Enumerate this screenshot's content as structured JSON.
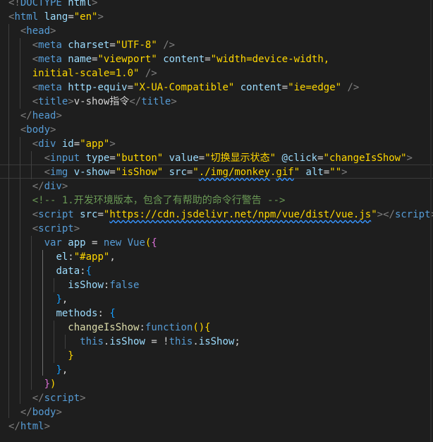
{
  "editor": {
    "lines": [
      [
        {
          "c": "t-punct",
          "t": "<!"
        },
        {
          "c": "t-tag",
          "t": "DOCTYPE"
        },
        {
          "c": "t-attr",
          "t": " html"
        },
        {
          "c": "t-punct",
          "t": ">"
        }
      ],
      [
        {
          "c": "t-punct",
          "t": "<"
        },
        {
          "c": "t-tag",
          "t": "html"
        },
        {
          "c": "t-attr",
          "t": " lang"
        },
        {
          "c": "t-text",
          "t": "="
        },
        {
          "c": "t-str",
          "t": "\"en\""
        },
        {
          "c": "t-punct",
          "t": ">"
        }
      ],
      [
        {
          "c": "t-text",
          "t": "  "
        },
        {
          "c": "t-punct",
          "t": "<"
        },
        {
          "c": "t-tag",
          "t": "head"
        },
        {
          "c": "t-punct",
          "t": ">"
        }
      ],
      [
        {
          "c": "t-text",
          "t": "    "
        },
        {
          "c": "t-punct",
          "t": "<"
        },
        {
          "c": "t-tag",
          "t": "meta"
        },
        {
          "c": "t-attr",
          "t": " charset"
        },
        {
          "c": "t-text",
          "t": "="
        },
        {
          "c": "t-str",
          "t": "\"UTF-8\""
        },
        {
          "c": "t-text",
          "t": " "
        },
        {
          "c": "t-punct",
          "t": "/>"
        }
      ],
      [
        {
          "c": "t-text",
          "t": "    "
        },
        {
          "c": "t-punct",
          "t": "<"
        },
        {
          "c": "t-tag",
          "t": "meta"
        },
        {
          "c": "t-attr",
          "t": " name"
        },
        {
          "c": "t-text",
          "t": "="
        },
        {
          "c": "t-str",
          "t": "\"viewport\""
        },
        {
          "c": "t-attr",
          "t": " content"
        },
        {
          "c": "t-text",
          "t": "="
        },
        {
          "c": "t-str",
          "t": "\"width=device-width,"
        }
      ],
      [
        {
          "c": "t-str",
          "t": "    initial-scale=1.0\""
        },
        {
          "c": "t-text",
          "t": " "
        },
        {
          "c": "t-punct",
          "t": "/>"
        }
      ],
      [
        {
          "c": "t-text",
          "t": "    "
        },
        {
          "c": "t-punct",
          "t": "<"
        },
        {
          "c": "t-tag",
          "t": "meta"
        },
        {
          "c": "t-attr",
          "t": " http-equiv"
        },
        {
          "c": "t-text",
          "t": "="
        },
        {
          "c": "t-str",
          "t": "\"X-UA-Compatible\""
        },
        {
          "c": "t-attr",
          "t": " content"
        },
        {
          "c": "t-text",
          "t": "="
        },
        {
          "c": "t-str",
          "t": "\"ie=edge\""
        },
        {
          "c": "t-text",
          "t": " "
        },
        {
          "c": "t-punct",
          "t": "/>"
        }
      ],
      [
        {
          "c": "t-text",
          "t": "    "
        },
        {
          "c": "t-punct",
          "t": "<"
        },
        {
          "c": "t-tag",
          "t": "title"
        },
        {
          "c": "t-punct",
          "t": ">"
        },
        {
          "c": "t-text",
          "t": "v-show指令"
        },
        {
          "c": "t-punct",
          "t": "</"
        },
        {
          "c": "t-tag",
          "t": "title"
        },
        {
          "c": "t-punct",
          "t": ">"
        }
      ],
      [
        {
          "c": "t-text",
          "t": "  "
        },
        {
          "c": "t-punct",
          "t": "</"
        },
        {
          "c": "t-tag",
          "t": "head"
        },
        {
          "c": "t-punct",
          "t": ">"
        }
      ],
      [
        {
          "c": "t-text",
          "t": "  "
        },
        {
          "c": "t-punct",
          "t": "<"
        },
        {
          "c": "t-tag",
          "t": "body"
        },
        {
          "c": "t-punct",
          "t": ">"
        }
      ],
      [
        {
          "c": "t-text",
          "t": "    "
        },
        {
          "c": "t-punct",
          "t": "<"
        },
        {
          "c": "t-tag",
          "t": "div"
        },
        {
          "c": "t-attr",
          "t": " id"
        },
        {
          "c": "t-text",
          "t": "="
        },
        {
          "c": "t-str",
          "t": "\"app\""
        },
        {
          "c": "t-punct",
          "t": ">"
        }
      ],
      [
        {
          "c": "t-text",
          "t": "      "
        },
        {
          "c": "t-punct",
          "t": "<"
        },
        {
          "c": "t-tag",
          "t": "input"
        },
        {
          "c": "t-attr",
          "t": " type"
        },
        {
          "c": "t-text",
          "t": "="
        },
        {
          "c": "t-str",
          "t": "\"button\""
        },
        {
          "c": "t-attr",
          "t": " value"
        },
        {
          "c": "t-text",
          "t": "="
        },
        {
          "c": "t-str",
          "t": "\"切换显示状态\""
        },
        {
          "c": "t-attr",
          "t": " @click"
        },
        {
          "c": "t-text",
          "t": "="
        },
        {
          "c": "t-str",
          "t": "\"changeIsShow\""
        },
        {
          "c": "t-punct",
          "t": ">"
        }
      ],
      [
        {
          "c": "t-text",
          "t": "      "
        },
        {
          "c": "t-punct",
          "t": "<"
        },
        {
          "c": "t-tag",
          "t": "img"
        },
        {
          "c": "t-attr",
          "t": " v-show"
        },
        {
          "c": "t-text",
          "t": "="
        },
        {
          "c": "t-str",
          "t": "\"isShow\""
        },
        {
          "c": "t-attr",
          "t": " src"
        },
        {
          "c": "t-text",
          "t": "="
        },
        {
          "c": "t-str",
          "t": "\""
        },
        {
          "c": "t-str wavy",
          "t": "./img/monkey"
        },
        {
          "c": "t-str",
          "t": "."
        },
        {
          "c": "t-str wavy",
          "t": "gif"
        },
        {
          "c": "t-str",
          "t": "\""
        },
        {
          "c": "t-attr",
          "t": " alt"
        },
        {
          "c": "t-text",
          "t": "="
        },
        {
          "c": "t-str",
          "t": "\"\""
        },
        {
          "c": "t-punct",
          "t": ">"
        }
      ],
      [
        {
          "c": "t-text",
          "t": "    "
        },
        {
          "c": "t-punct",
          "t": "</"
        },
        {
          "c": "t-tag",
          "t": "div"
        },
        {
          "c": "t-punct",
          "t": ">"
        }
      ],
      [
        {
          "c": "t-text",
          "t": "    "
        },
        {
          "c": "t-comment",
          "t": "<!-- 1.开发环境版本，包含了有帮助的命令行警告 -->"
        }
      ],
      [
        {
          "c": "t-text",
          "t": "    "
        },
        {
          "c": "t-punct",
          "t": "<"
        },
        {
          "c": "t-tag",
          "t": "script"
        },
        {
          "c": "t-attr",
          "t": " src"
        },
        {
          "c": "t-text",
          "t": "="
        },
        {
          "c": "t-str",
          "t": "\""
        },
        {
          "c": "t-str wavy",
          "t": "https://cdn.jsdelivr.net/npm/vue/dist/vue.js"
        },
        {
          "c": "t-str",
          "t": "\""
        },
        {
          "c": "t-punct",
          "t": "></"
        },
        {
          "c": "t-tag",
          "t": "script"
        },
        {
          "c": "t-punct",
          "t": ">"
        }
      ],
      [
        {
          "c": "t-text",
          "t": "    "
        },
        {
          "c": "t-punct",
          "t": "<"
        },
        {
          "c": "t-tag",
          "t": "script"
        },
        {
          "c": "t-punct",
          "t": ">"
        }
      ],
      [
        {
          "c": "t-text",
          "t": "      "
        },
        {
          "c": "t-kw",
          "t": "var"
        },
        {
          "c": "t-prop",
          "t": " app"
        },
        {
          "c": "t-op",
          "t": " = "
        },
        {
          "c": "t-kw",
          "t": "new"
        },
        {
          "c": "t-ghost",
          "t": " "
        },
        {
          "c": "t-tag",
          "t": "Vue"
        },
        {
          "c": "t-yellowbrace",
          "t": "("
        },
        {
          "c": "t-pinkbrace",
          "t": "{"
        }
      ],
      [
        {
          "c": "t-text",
          "t": "        "
        },
        {
          "c": "t-prop",
          "t": "el"
        },
        {
          "c": "t-text",
          "t": ":"
        },
        {
          "c": "t-str",
          "t": "\"#app\""
        },
        {
          "c": "t-text",
          "t": ","
        }
      ],
      [
        {
          "c": "t-text",
          "t": "        "
        },
        {
          "c": "t-prop",
          "t": "data"
        },
        {
          "c": "t-text",
          "t": ":"
        },
        {
          "c": "t-bluebrace",
          "t": "{"
        }
      ],
      [
        {
          "c": "t-text",
          "t": "          "
        },
        {
          "c": "t-prop",
          "t": "isShow"
        },
        {
          "c": "t-text",
          "t": ":"
        },
        {
          "c": "t-kw",
          "t": "false"
        }
      ],
      [
        {
          "c": "t-text",
          "t": "        "
        },
        {
          "c": "t-bluebrace",
          "t": "}"
        },
        {
          "c": "t-text",
          "t": ","
        }
      ],
      [
        {
          "c": "t-text",
          "t": "        "
        },
        {
          "c": "t-prop",
          "t": "methods"
        },
        {
          "c": "t-text",
          "t": ": "
        },
        {
          "c": "t-bluebrace",
          "t": "{"
        }
      ],
      [
        {
          "c": "t-text",
          "t": "          "
        },
        {
          "c": "t-fn",
          "t": "changeIsShow"
        },
        {
          "c": "t-text",
          "t": ":"
        },
        {
          "c": "t-kw",
          "t": "function"
        },
        {
          "c": "t-yellowbrace",
          "t": "(){"
        }
      ],
      [
        {
          "c": "t-text",
          "t": "            "
        },
        {
          "c": "t-kw",
          "t": "this"
        },
        {
          "c": "t-text",
          "t": "."
        },
        {
          "c": "t-prop",
          "t": "isShow"
        },
        {
          "c": "t-op",
          "t": " = !"
        },
        {
          "c": "t-kw",
          "t": "this"
        },
        {
          "c": "t-text",
          "t": "."
        },
        {
          "c": "t-prop",
          "t": "isShow"
        },
        {
          "c": "t-text",
          "t": ";"
        }
      ],
      [
        {
          "c": "t-text",
          "t": "          "
        },
        {
          "c": "t-yellowbrace",
          "t": "}"
        }
      ],
      [
        {
          "c": "t-text",
          "t": "        "
        },
        {
          "c": "t-bluebrace",
          "t": "}"
        },
        {
          "c": "t-text",
          "t": ","
        }
      ],
      [
        {
          "c": "t-text",
          "t": "      "
        },
        {
          "c": "t-pinkbrace",
          "t": "}"
        },
        {
          "c": "t-yellowbrace",
          "t": ")"
        }
      ],
      [
        {
          "c": "t-text",
          "t": "    "
        },
        {
          "c": "t-punct",
          "t": "</"
        },
        {
          "c": "t-tag",
          "t": "script"
        },
        {
          "c": "t-punct",
          "t": ">"
        }
      ],
      [
        {
          "c": "t-text",
          "t": "  "
        },
        {
          "c": "t-punct",
          "t": "</"
        },
        {
          "c": "t-tag",
          "t": "body"
        },
        {
          "c": "t-punct",
          "t": ">"
        }
      ],
      [
        {
          "c": "t-punct",
          "t": "</"
        },
        {
          "c": "t-tag",
          "t": "html"
        },
        {
          "c": "t-punct",
          "t": ">"
        }
      ]
    ]
  }
}
